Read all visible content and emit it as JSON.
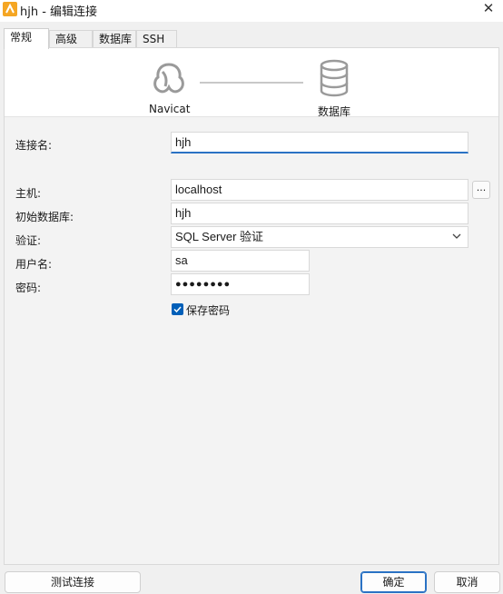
{
  "window": {
    "title": "hjh - 编辑连接",
    "close_glyph": "✕"
  },
  "tabs": [
    {
      "label": "常规"
    },
    {
      "label": "高级"
    },
    {
      "label": "数据库"
    },
    {
      "label": "SSH"
    }
  ],
  "diagram": {
    "left_label": "Navicat",
    "right_label": "数据库"
  },
  "form": {
    "connection_name": {
      "label": "连接名:",
      "value": "hjh"
    },
    "host": {
      "label": "主机:",
      "value": "localhost",
      "button_label": "..."
    },
    "initial_database": {
      "label": "初始数据库:",
      "value": "hjh"
    },
    "authentication": {
      "label": "验证:",
      "value": "SQL Server 验证"
    },
    "username": {
      "label": "用户名:",
      "value": "sa"
    },
    "password": {
      "label": "密码:",
      "value": "●●●●●●●●"
    },
    "save_password": {
      "label": "保存密码",
      "checked": true
    }
  },
  "footer": {
    "test_label": "测试连接",
    "ok_label": "确定",
    "cancel_label": "取消"
  },
  "colors": {
    "accent": "#005fb8",
    "focus_underline": "#2a72c4",
    "app_icon": "#f5a623"
  }
}
